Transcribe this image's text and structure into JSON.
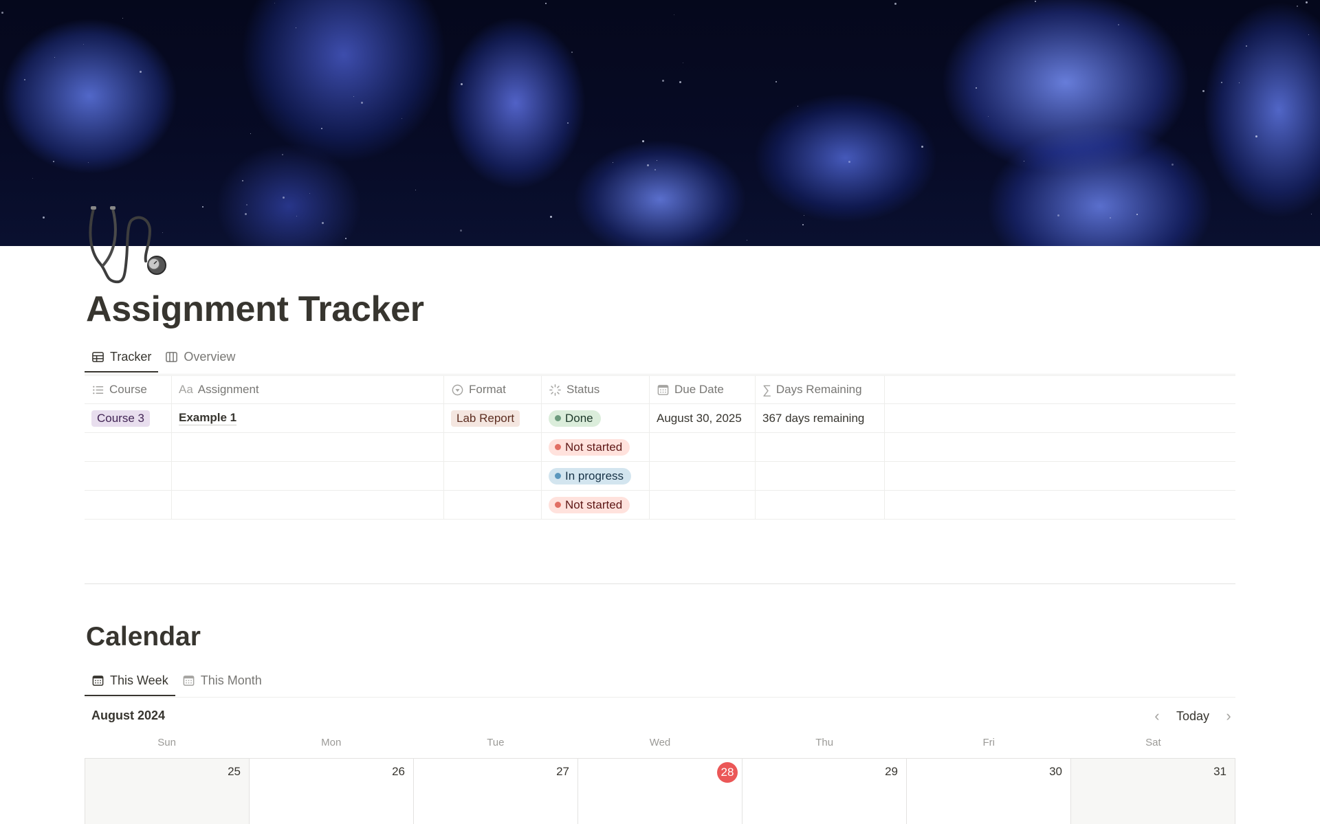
{
  "page": {
    "icon": "stethoscope-icon",
    "title": "Assignment Tracker",
    "colors": {
      "accent_today": "#eb5757",
      "text": "#37352f",
      "muted": "#787774"
    }
  },
  "tracker": {
    "tabs": [
      {
        "label": "Tracker",
        "icon": "table-icon",
        "active": true
      },
      {
        "label": "Overview",
        "icon": "board-icon",
        "active": false
      }
    ],
    "columns": [
      {
        "label": "Course",
        "icon": "list-icon"
      },
      {
        "label": "Assignment",
        "icon": "text-type-icon"
      },
      {
        "label": "Format",
        "icon": "select-icon"
      },
      {
        "label": "Status",
        "icon": "status-icon"
      },
      {
        "label": "Due Date",
        "icon": "calendar-icon"
      },
      {
        "label": "Days Remaining",
        "icon": "formula-sigma-icon"
      }
    ],
    "rows": [
      {
        "course": "Course 3",
        "assignment": "Example 1",
        "format": "Lab Report",
        "status": "Done",
        "due_date": "August 30, 2025",
        "days_remaining": "367 days remaining"
      },
      {
        "course": "",
        "assignment": "",
        "format": "",
        "status": "Not started",
        "due_date": "",
        "days_remaining": ""
      },
      {
        "course": "",
        "assignment": "",
        "format": "",
        "status": "In progress",
        "due_date": "",
        "days_remaining": ""
      },
      {
        "course": "",
        "assignment": "",
        "format": "",
        "status": "Not started",
        "due_date": "",
        "days_remaining": ""
      }
    ],
    "status_colors": {
      "Done": "#6c9b7d",
      "Not started": "#e16f64",
      "In progress": "#5b97bd"
    }
  },
  "calendar": {
    "title": "Calendar",
    "tabs": [
      {
        "label": "This Week",
        "icon": "calendar-icon",
        "active": true
      },
      {
        "label": "This Month",
        "icon": "calendar-icon",
        "active": false
      }
    ],
    "month_label": "August 2024",
    "today_label": "Today",
    "day_names": [
      "Sun",
      "Mon",
      "Tue",
      "Wed",
      "Thu",
      "Fri",
      "Sat"
    ],
    "dates": [
      "25",
      "26",
      "27",
      "28",
      "29",
      "30",
      "31"
    ],
    "today_index": 3
  }
}
